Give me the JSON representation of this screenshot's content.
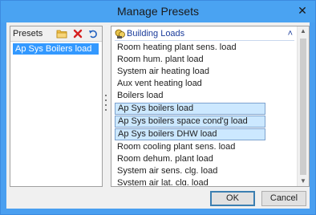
{
  "window": {
    "title": "Manage Presets",
    "close_glyph": "✕"
  },
  "presets": {
    "header_label": "Presets",
    "toolbar": [
      {
        "name": "folder-icon"
      },
      {
        "name": "delete-icon"
      },
      {
        "name": "undo-icon"
      }
    ],
    "items": [
      {
        "label": "Ap Sys Boilers load",
        "selected": true
      }
    ]
  },
  "loads": {
    "group_title": "Building Loads",
    "group_toggle_glyph": "˄",
    "items": [
      {
        "label": "Room heating plant sens. load",
        "selected": false
      },
      {
        "label": "Room hum. plant load",
        "selected": false
      },
      {
        "label": "System air heating load",
        "selected": false
      },
      {
        "label": "Aux vent heating load",
        "selected": false
      },
      {
        "label": "Boilers load",
        "selected": false
      },
      {
        "label": "Ap Sys boilers load",
        "selected": true
      },
      {
        "label": "Ap Sys boilers space cond'g load",
        "selected": true
      },
      {
        "label": "Ap Sys boilers DHW load",
        "selected": true
      },
      {
        "label": "Room cooling plant sens. load",
        "selected": false
      },
      {
        "label": "Room dehum. plant load",
        "selected": false
      },
      {
        "label": "System air sens. clg. load",
        "selected": false
      },
      {
        "label": "System air lat. clg. load",
        "selected": false
      }
    ],
    "scroll_up_glyph": "▲",
    "scroll_down_glyph": "▼"
  },
  "buttons": {
    "ok_label": "OK",
    "cancel_label": "Cancel"
  },
  "colors": {
    "titlebar": "#4aa3f2",
    "selection": "#3399ff",
    "item_highlight": "#cce8ff",
    "group_text": "#1a3b9a"
  }
}
